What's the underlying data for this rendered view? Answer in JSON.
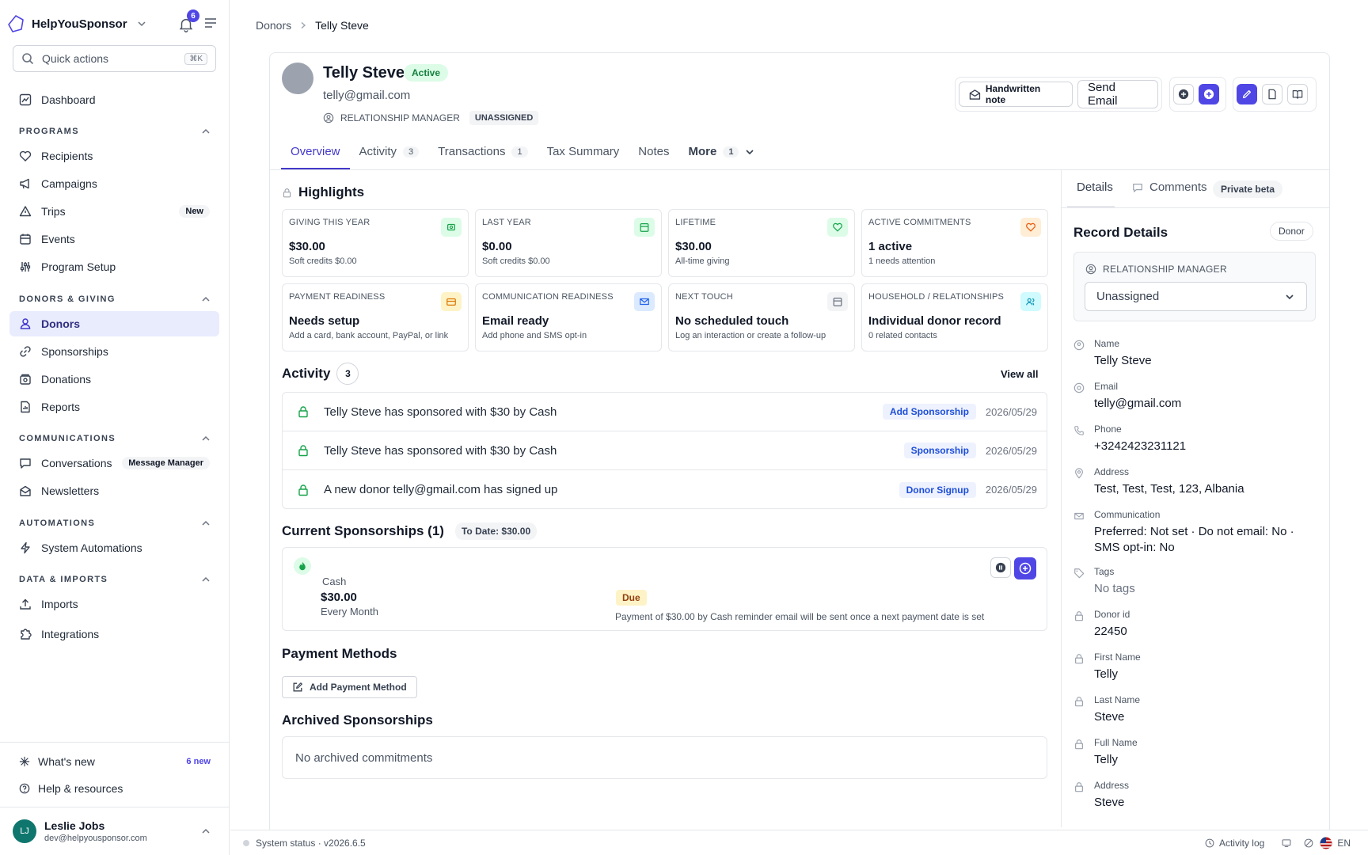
{
  "app": {
    "brand": "HelpYouSponsor",
    "notifications": "6",
    "quick_actions": "Quick actions",
    "quick_shortcut": "⌘K"
  },
  "sidebar": {
    "dashboard": "Dashboard",
    "programs_title": "PROGRAMS",
    "recipients": "Recipients",
    "campaigns": "Campaigns",
    "trips": "Trips",
    "trips_badge": "New",
    "events": "Events",
    "program_setup": "Program Setup",
    "donors_title": "DONORS & GIVING",
    "donors": "Donors",
    "sponsorships": "Sponsorships",
    "donations": "Donations",
    "reports": "Reports",
    "comms_title": "COMMUNICATIONS",
    "conversations": "Conversations",
    "conversations_badge": "Message Manager",
    "newsletters": "Newsletters",
    "automations_title": "AUTOMATIONS",
    "system_automations": "System Automations",
    "data_title": "DATA & IMPORTS",
    "imports": "Imports",
    "integrations": "Integrations",
    "whats_new": "What's new",
    "whats_new_count": "6 new",
    "help": "Help & resources",
    "user_initials": "LJ",
    "user_name": "Leslie Jobs",
    "user_email": "dev@helpyousponsor.com"
  },
  "breadcrumb": {
    "parent": "Donors",
    "current": "Telly Steve"
  },
  "donor": {
    "name": "Telly Steve",
    "status": "Active",
    "email": "telly@gmail.com",
    "rm_label": "RELATIONSHIP MANAGER",
    "rm_value": "UNASSIGNED"
  },
  "actions": {
    "handwritten": "Handwritten note",
    "send_email": "Send Email"
  },
  "tabs": [
    {
      "label": "Overview",
      "count": ""
    },
    {
      "label": "Activity",
      "count": "3"
    },
    {
      "label": "Transactions",
      "count": "1"
    },
    {
      "label": "Tax Summary",
      "count": ""
    },
    {
      "label": "Notes",
      "count": ""
    },
    {
      "label": "More",
      "count": "1"
    }
  ],
  "highlights": {
    "title": "Highlights",
    "cards": [
      {
        "label": "GIVING THIS YEAR",
        "value": "$30.00",
        "sub": "Soft credits $0.00",
        "color": "#16a34a",
        "bg": "#dcfce7"
      },
      {
        "label": "LAST YEAR",
        "value": "$0.00",
        "sub": "Soft credits $0.00",
        "color": "#16a34a",
        "bg": "#dcfce7"
      },
      {
        "label": "LIFETIME",
        "value": "$30.00",
        "sub": "All-time giving",
        "color": "#16a34a",
        "bg": "#dcfce7"
      },
      {
        "label": "ACTIVE COMMITMENTS",
        "value": "1 active",
        "sub": "1 needs attention",
        "color": "#ea580c",
        "bg": "#ffedd5"
      },
      {
        "label": "PAYMENT READINESS",
        "value": "Needs setup",
        "sub": "Add a card, bank account, PayPal, or link",
        "color": "#d97706",
        "bg": "#fef3c7"
      },
      {
        "label": "COMMUNICATION READINESS",
        "value": "Email ready",
        "sub": "Add phone and SMS opt-in",
        "color": "#2563eb",
        "bg": "#dbeafe"
      },
      {
        "label": "NEXT TOUCH",
        "value": "No scheduled touch",
        "sub": "Log an interaction or create a follow-up",
        "color": "#6b7280",
        "bg": "#f3f4f6"
      },
      {
        "label": "HOUSEHOLD / RELATIONSHIPS",
        "value": "Individual donor record",
        "sub": "0 related contacts",
        "color": "#0891b2",
        "bg": "#cffafe"
      }
    ]
  },
  "activity": {
    "title": "Activity",
    "count": "3",
    "view_all": "View all",
    "rows": [
      {
        "text": "Telly Steve has sponsored with $30 by Cash",
        "tag": "Add Sponsorship",
        "date": "2026/05/29"
      },
      {
        "text": "Telly Steve has sponsored with $30 by Cash",
        "tag": "Sponsorship",
        "date": "2026/05/29"
      },
      {
        "text": "A new donor telly@gmail.com has signed up",
        "tag": "Donor Signup",
        "date": "2026/05/29"
      }
    ]
  },
  "sponsorships": {
    "title": "Current Sponsorships (1)",
    "to_date": "To Date: $30.00",
    "method": "Cash",
    "amount": "$30.00",
    "frequency": "Every Month",
    "status": "Due",
    "note": "Payment of $30.00 by Cash reminder email will be sent once a next payment date is set"
  },
  "payment_methods": {
    "title": "Payment Methods",
    "add": "Add Payment Method"
  },
  "archived": {
    "title": "Archived Sponsorships",
    "empty": "No archived commitments"
  },
  "right_panel": {
    "tab_details": "Details",
    "tab_comments": "Comments",
    "private_beta": "Private beta",
    "title": "Record Details",
    "type": "Donor",
    "rm_label": "RELATIONSHIP MANAGER",
    "rm_value": "Unassigned",
    "fields": [
      {
        "label": "Name",
        "value": "Telly Steve"
      },
      {
        "label": "Email",
        "value": "telly@gmail.com"
      },
      {
        "label": "Phone",
        "value": "+3242423231121"
      },
      {
        "label": "Address",
        "value": "Test, Test, Test, 123, Albania"
      },
      {
        "label": "Communication",
        "value": "Preferred: Not set · Do not email: No · SMS opt-in: No"
      },
      {
        "label": "Tags",
        "value": "No tags"
      },
      {
        "label": "Donor id",
        "value": "22450"
      },
      {
        "label": "First Name",
        "value": "Telly"
      },
      {
        "label": "Last Name",
        "value": "Steve"
      },
      {
        "label": "Full Name",
        "value": "Telly"
      },
      {
        "label": "Address",
        "value": "Steve"
      }
    ]
  },
  "statusbar": {
    "status": "System status · v2026.6.5",
    "activity_log": "Activity log",
    "lang": "EN"
  },
  "colors": {
    "accent": "#4f46e5",
    "active_bg": "#e9ecfd"
  }
}
